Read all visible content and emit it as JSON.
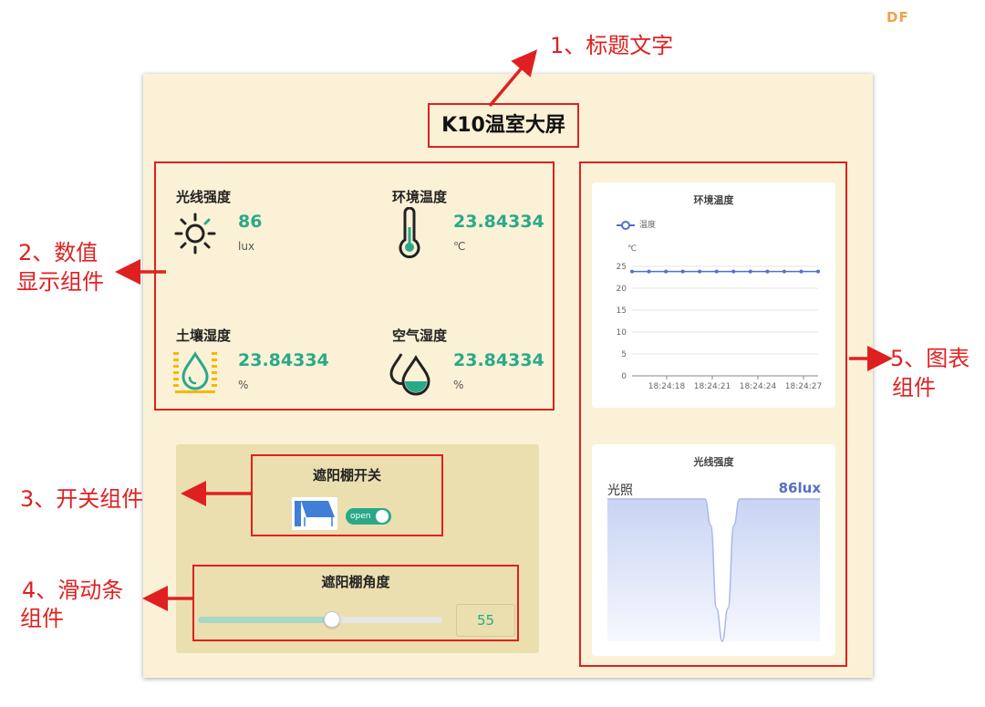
{
  "watermark": "DF",
  "screen": {
    "title": "K10温室大屏"
  },
  "metrics": [
    {
      "label": "光线强度",
      "value": "86",
      "unit": "lux",
      "icon": "sun-icon"
    },
    {
      "label": "环境温度",
      "value": "23.84334",
      "unit": "℃",
      "icon": "thermometer-icon"
    },
    {
      "label": "土壤湿度",
      "value": "23.84334",
      "unit": "%",
      "icon": "soil-drop-icon"
    },
    {
      "label": "空气湿度",
      "value": "23.84334",
      "unit": "%",
      "icon": "water-drops-icon"
    }
  ],
  "switch": {
    "title": "遮阳棚开关",
    "toggle_label": "open",
    "state": "on",
    "icon": "awning-icon"
  },
  "slider": {
    "title": "遮阳棚角度",
    "value": "55",
    "min": 0,
    "max": 100,
    "fraction": 0.55
  },
  "annotations": {
    "a1": "1、标题文字",
    "a2_line1": "2、数值",
    "a2_line2": "显示组件",
    "a3": "3、开关组件",
    "a4_line1": "4、滑动条",
    "a4_line2": "组件",
    "a5_line1": "5、图表",
    "a5_line2": "组件"
  },
  "colors": {
    "accent_green": "#2aa989",
    "annotation_red": "#e02020",
    "panel_bg": "#fbf1d6",
    "control_bg": "#ebdfb0",
    "line_blue": "#5470c6",
    "watermark": "#f5a04a"
  },
  "chart_data": [
    {
      "type": "line",
      "title": "环境温度",
      "series": [
        {
          "name": "温度",
          "values": [
            23.84,
            23.84,
            23.84,
            23.84,
            23.84,
            23.84,
            23.84,
            23.84,
            23.84,
            23.84,
            23.84,
            23.84
          ]
        }
      ],
      "x_tick_labels": [
        "18:24:18",
        "18:24:21",
        "18:24:24",
        "18:24:27"
      ],
      "ylabel": "℃",
      "ylim": [
        0,
        25
      ],
      "y_ticks": [
        0,
        5,
        10,
        15,
        20,
        25
      ],
      "grid": true,
      "legend": "top-left"
    },
    {
      "type": "area",
      "title": "光线强度",
      "left_label": "光照",
      "right_label": "86lux",
      "description_series": "light level with sharp dip",
      "values": [
        86,
        86,
        86,
        86,
        86,
        86,
        86,
        86,
        86,
        86,
        86,
        86,
        86,
        86,
        86,
        86,
        86,
        86,
        70,
        20,
        0,
        20,
        70,
        86,
        86,
        86,
        86,
        86,
        86,
        86,
        86,
        86,
        86,
        86,
        86,
        86,
        86,
        86
      ],
      "ylim": [
        0,
        86
      ]
    }
  ]
}
